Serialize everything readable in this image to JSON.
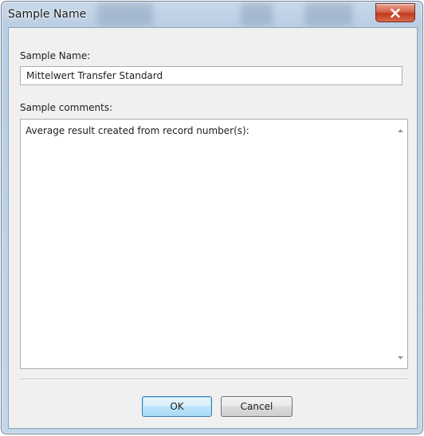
{
  "window": {
    "title": "Sample Name",
    "close_icon": "close-icon"
  },
  "form": {
    "sample_name_label": "Sample Name:",
    "sample_name_value": "Mittelwert Transfer Standard",
    "comments_label": "Sample comments:",
    "comments_value": "Average result created from record number(s):"
  },
  "buttons": {
    "ok_label": "OK",
    "cancel_label": "Cancel"
  },
  "colors": {
    "titlebar": "#bfd2e6",
    "close_button": "#c2391f",
    "default_button_border": "#3c7fb1"
  }
}
